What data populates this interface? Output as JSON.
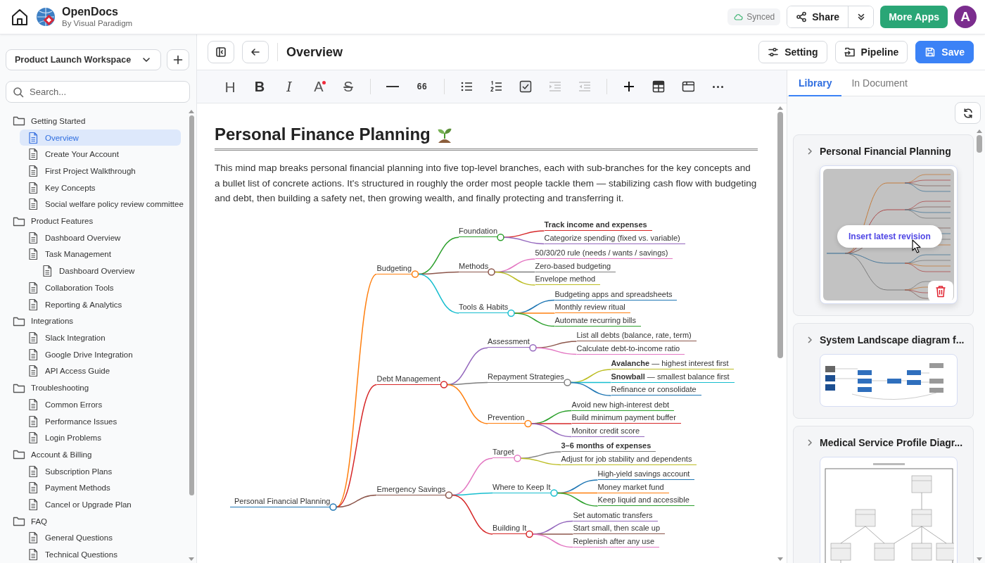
{
  "app": {
    "name": "OpenDocs",
    "subtitle": "By Visual Paradigm"
  },
  "sync_status": "Synced",
  "share_button": "Share",
  "more_apps_button": "More Apps",
  "avatar": "A",
  "workspace": {
    "name": "Product Launch Workspace"
  },
  "search": {
    "placeholder": "Search..."
  },
  "tree": [
    {
      "label": "Getting Started",
      "kind": "folder",
      "selected": false,
      "children": [
        {
          "label": "Overview",
          "kind": "doc",
          "selected": true
        },
        {
          "label": "Create Your Account",
          "kind": "doc",
          "selected": false
        },
        {
          "label": "First Project Walkthrough",
          "kind": "doc",
          "selected": false
        },
        {
          "label": "Key Concepts",
          "kind": "doc",
          "selected": false
        },
        {
          "label": "Social welfare policy review committee",
          "kind": "doc",
          "selected": false
        }
      ]
    },
    {
      "label": "Product Features",
      "kind": "folder",
      "selected": false,
      "children": [
        {
          "label": "Dashboard Overview",
          "kind": "doc",
          "selected": false
        },
        {
          "label": "Task Management",
          "kind": "doc",
          "selected": false,
          "children": [
            {
              "label": "Dashboard Overview",
              "kind": "doc",
              "selected": false
            }
          ]
        },
        {
          "label": "Collaboration Tools",
          "kind": "doc",
          "selected": false
        },
        {
          "label": "Reporting & Analytics",
          "kind": "doc",
          "selected": false
        }
      ]
    },
    {
      "label": "Integrations",
      "kind": "folder",
      "selected": false,
      "children": [
        {
          "label": "Slack Integration",
          "kind": "doc",
          "selected": false
        },
        {
          "label": "Google Drive Integration",
          "kind": "doc",
          "selected": false
        },
        {
          "label": "API Access Guide",
          "kind": "doc",
          "selected": false
        }
      ]
    },
    {
      "label": "Troubleshooting",
      "kind": "folder",
      "selected": false,
      "children": [
        {
          "label": "Common Errors",
          "kind": "doc",
          "selected": false
        },
        {
          "label": "Performance Issues",
          "kind": "doc",
          "selected": false
        },
        {
          "label": "Login Problems",
          "kind": "doc",
          "selected": false
        }
      ]
    },
    {
      "label": "Account & Billing",
      "kind": "folder",
      "selected": false,
      "children": [
        {
          "label": "Subscription Plans",
          "kind": "doc",
          "selected": false
        },
        {
          "label": "Payment Methods",
          "kind": "doc",
          "selected": false
        },
        {
          "label": "Cancel or Upgrade Plan",
          "kind": "doc",
          "selected": false
        }
      ]
    },
    {
      "label": "FAQ",
      "kind": "folder",
      "selected": false,
      "children": [
        {
          "label": "General Questions",
          "kind": "doc",
          "selected": false
        },
        {
          "label": "Technical Questions",
          "kind": "doc",
          "selected": false
        }
      ]
    }
  ],
  "page": {
    "title": "Overview"
  },
  "actions": [
    {
      "label": "Setting",
      "kind": "setting",
      "primary": false
    },
    {
      "label": "Pipeline",
      "kind": "pipeline",
      "primary": false
    },
    {
      "label": "Save",
      "kind": "save",
      "primary": true
    }
  ],
  "toolbar": [
    {
      "kind": "heading",
      "glyph": "H",
      "disabled": false
    },
    {
      "kind": "bold",
      "glyph": "B",
      "disabled": false
    },
    {
      "kind": "italic",
      "glyph": "I",
      "disabled": false
    },
    {
      "kind": "text-color",
      "glyph": "A",
      "color": "#ef2b3c",
      "disabled": false
    },
    {
      "kind": "strike",
      "glyph": "S",
      "disabled": false
    },
    {
      "kind": "divider"
    },
    {
      "kind": "rule",
      "disabled": false
    },
    {
      "kind": "quote",
      "glyph": "66",
      "disabled": false
    },
    {
      "kind": "divider"
    },
    {
      "kind": "bullets",
      "disabled": false
    },
    {
      "kind": "numbers",
      "disabled": false
    },
    {
      "kind": "checklist",
      "disabled": false
    },
    {
      "kind": "indent",
      "disabled": true
    },
    {
      "kind": "outdent",
      "disabled": true
    },
    {
      "kind": "divider"
    },
    {
      "kind": "insert",
      "disabled": false
    },
    {
      "kind": "table",
      "disabled": false
    },
    {
      "kind": "embed",
      "disabled": false
    },
    {
      "kind": "more",
      "disabled": false
    }
  ],
  "document": {
    "heading": "Personal Finance Planning",
    "paragraph": "This mind map breaks personal financial planning into five top-level branches, each with sub-branches for the key concepts and a bullet list of concrete actions. It's structured in roughly the order most people tackle them — stabilizing cash flow with budgeting and debt, then building a safety net, then growing wealth, and finally protecting and transferring it."
  },
  "mind_map": {
    "label": "Personal Financial Planning",
    "color": "#1f77b4",
    "children": [
      {
        "label": "Budgeting",
        "color": "#ff7f0e",
        "children": [
          {
            "label": "Foundation",
            "color": "#2ca02c",
            "children": [
              {
                "label": "Track income and expenses",
                "color": "#d62728",
                "bold": true
              },
              {
                "label": "Categorize spending (fixed vs. variable)",
                "color": "#9467bd",
                "bold": false
              }
            ]
          },
          {
            "label": "Methods",
            "color": "#8c564b",
            "children": [
              {
                "label": "50/30/20 rule (needs / wants / savings)",
                "color": "#e377c2",
                "bold": false
              },
              {
                "label": "Zero-based budgeting",
                "color": "#7f7f7f",
                "bold": false
              },
              {
                "label": "Envelope method",
                "color": "#bcbd22",
                "bold": false
              }
            ]
          },
          {
            "label": "Tools & Habits",
            "color": "#17becf",
            "children": [
              {
                "label": "Budgeting apps and spreadsheets",
                "color": "#1f77b4",
                "bold": false
              },
              {
                "label": "Monthly review ritual",
                "color": "#ff7f0e",
                "bold": false
              },
              {
                "label": "Automate recurring bills",
                "color": "#2ca02c",
                "bold": false
              }
            ]
          }
        ]
      },
      {
        "label": "Debt Management",
        "color": "#d62728",
        "children": [
          {
            "label": "Assessment",
            "color": "#9467bd",
            "children": [
              {
                "label": "List all debts (balance, rate, term)",
                "color": "#8c564b",
                "bold": false
              },
              {
                "label": "Calculate debt-to-income ratio",
                "color": "#e377c2",
                "bold": false
              }
            ]
          },
          {
            "label": "Repayment Strategies",
            "color": "#7f7f7f",
            "children": [
              {
                "label": "**Avalanche** — highest interest first",
                "color": "#bcbd22",
                "bold": false
              },
              {
                "label": "**Snowball** — smallest balance first",
                "color": "#17becf",
                "bold": false
              },
              {
                "label": "Refinance or consolidate",
                "color": "#1f77b4",
                "bold": false
              }
            ]
          },
          {
            "label": "Prevention",
            "color": "#ff7f0e",
            "children": [
              {
                "label": "Avoid new high-interest debt",
                "color": "#2ca02c",
                "bold": false
              },
              {
                "label": "Build minimum payment buffer",
                "color": "#d62728",
                "bold": false
              },
              {
                "label": "Monitor credit score",
                "color": "#9467bd",
                "bold": false
              }
            ]
          }
        ]
      },
      {
        "label": "Emergency Savings",
        "color": "#8c564b",
        "children": [
          {
            "label": "Target",
            "color": "#e377c2",
            "children": [
              {
                "label": "3–6 months of expenses",
                "color": "#7f7f7f",
                "bold": true
              },
              {
                "label": "Adjust for job stability and dependents",
                "color": "#bcbd22",
                "bold": false
              }
            ]
          },
          {
            "label": "Where to Keep It",
            "color": "#17becf",
            "children": [
              {
                "label": "High-yield savings account",
                "color": "#1f77b4",
                "bold": false
              },
              {
                "label": "Money market fund",
                "color": "#ff7f0e",
                "bold": false
              },
              {
                "label": "Keep liquid and accessible",
                "color": "#2ca02c",
                "bold": false
              }
            ]
          },
          {
            "label": "Building It",
            "color": "#d62728",
            "children": [
              {
                "label": "Set automatic transfers",
                "color": "#9467bd",
                "bold": false
              },
              {
                "label": "Start small, then scale up",
                "color": "#8c564b",
                "bold": false
              },
              {
                "label": "Replenish after any use",
                "color": "#e377c2",
                "bold": false
              }
            ]
          }
        ]
      }
    ]
  },
  "panel_tabs": [
    {
      "label": "Library",
      "selected": true
    },
    {
      "label": "In Document",
      "selected": false
    }
  ],
  "library": [
    {
      "title": "Personal Financial Planning",
      "kind": "mind-map",
      "hovered": true,
      "hover_action": "Insert latest revision"
    },
    {
      "title": "System Landscape diagram f...",
      "kind": "landscape",
      "hovered": false
    },
    {
      "title": "Medical Service Profile Diagr...",
      "kind": "class",
      "hovered": false
    }
  ]
}
